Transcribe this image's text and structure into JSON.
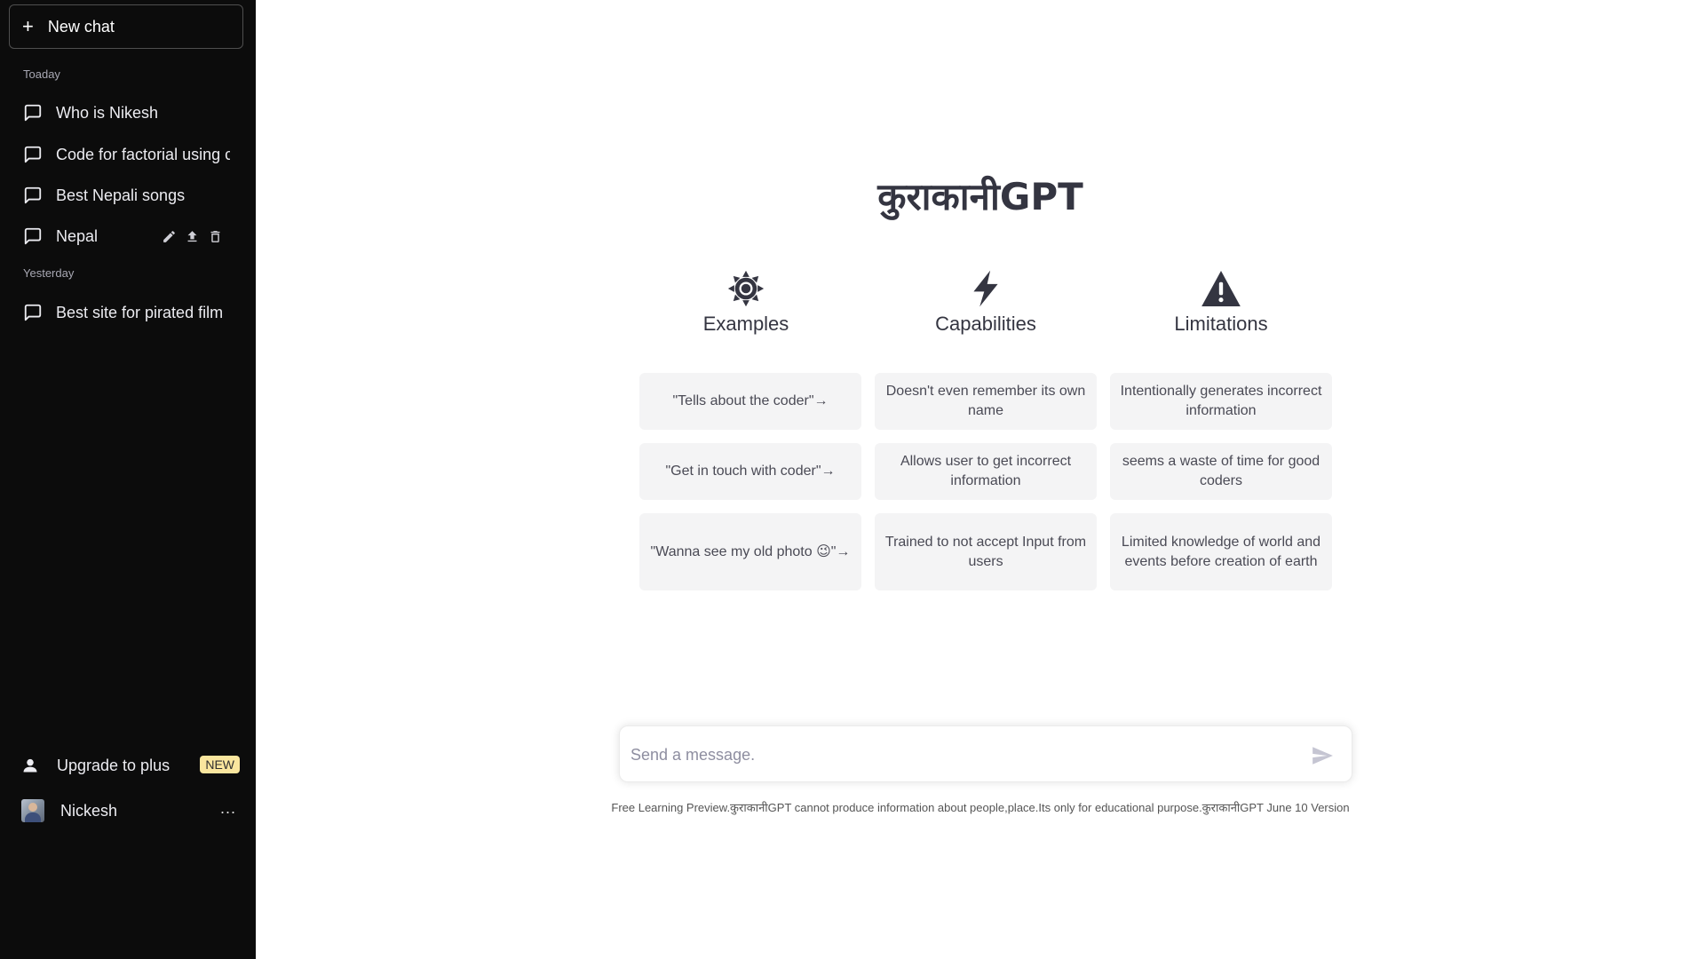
{
  "sidebar": {
    "new_chat_label": "New chat",
    "sections": [
      {
        "label": "Toaday"
      },
      {
        "label": "Yesterday"
      }
    ],
    "chats": [
      {
        "label": "Who is Nikesh"
      },
      {
        "label": "Code for factorial using c"
      },
      {
        "label": "Best Nepali songs"
      },
      {
        "label": "Nepal"
      },
      {
        "label": "Best site for pirated film"
      }
    ],
    "upgrade_label": "Upgrade to plus",
    "upgrade_badge": "NEW",
    "user_name": "Nickesh",
    "more_label": "..."
  },
  "main": {
    "title": "कुराकानीGPT",
    "columns": [
      {
        "icon": "sun-icon",
        "title": "Examples",
        "cards": [
          "\"Tells about the coder\"→",
          "\"Get in touch with coder\"→",
          "\"Wanna see my old photo 😉\"→"
        ]
      },
      {
        "icon": "lightning-icon",
        "title": "Capabilities",
        "cards": [
          "Doesn't even remember its own name",
          "Allows user to get incorrect information",
          "Trained to not accept Input from users"
        ]
      },
      {
        "icon": "warning-icon",
        "title": "Limitations",
        "cards": [
          "Intentionally generates incorrect information",
          "seems a waste of time for good coders",
          "Limited knowledge of world and events before creation of earth"
        ]
      }
    ]
  },
  "composer": {
    "placeholder": "Send a message.",
    "value": ""
  },
  "footer": {
    "note": "Free Learning Preview.कुराकानीGPT cannot produce information about people,place.Its only for educational purpose.कुराकानीGPT June 10 Version"
  },
  "colors": {
    "sidebar_bg": "#0c0c0c",
    "card_bg": "#f4f4f5",
    "badge_bg": "#fae69e",
    "text_dark": "#343541"
  }
}
